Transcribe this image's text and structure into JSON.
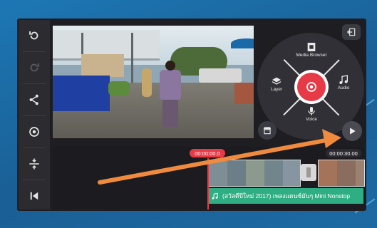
{
  "colors": {
    "accent_red": "#e83a46",
    "audio_green": "#2fae84",
    "arrow_orange": "#f08a3e"
  },
  "toolbar": {
    "items": [
      {
        "icon": "undo-icon"
      },
      {
        "icon": "redo-icon"
      },
      {
        "icon": "share-icon"
      },
      {
        "icon": "settings-icon"
      },
      {
        "icon": "timeline-expand-icon"
      },
      {
        "icon": "skip-to-start-icon"
      }
    ]
  },
  "wheel": {
    "media_browser": "Media Browser",
    "layer": "Layer",
    "audio": "Audio",
    "voice": "Voice"
  },
  "timeline": {
    "current_time": "00:00:00.0",
    "end_time": "00:00:30.00",
    "audio_track_title": "(สวัสดีปีใหม่ 2017) เพลงแดนซ์มันๆ Mini Nonstop"
  }
}
